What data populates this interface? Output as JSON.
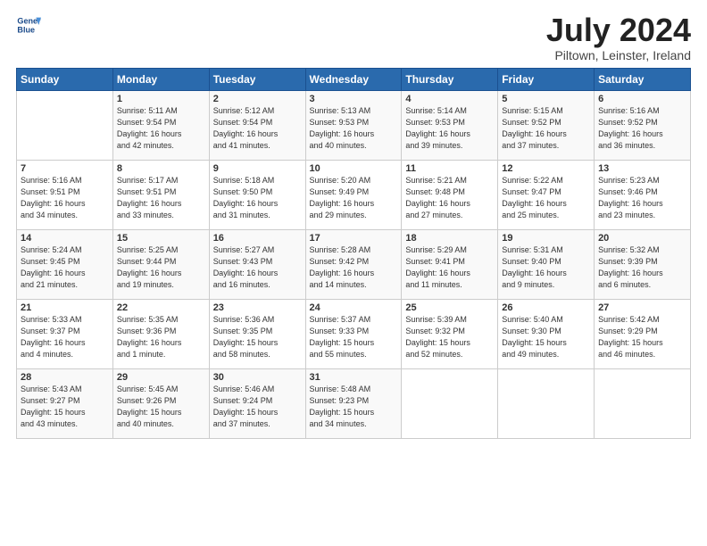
{
  "header": {
    "logo_line1": "General",
    "logo_line2": "Blue",
    "title": "July 2024",
    "subtitle": "Piltown, Leinster, Ireland"
  },
  "calendar": {
    "headers": [
      "Sunday",
      "Monday",
      "Tuesday",
      "Wednesday",
      "Thursday",
      "Friday",
      "Saturday"
    ],
    "weeks": [
      [
        {
          "day": "",
          "info": ""
        },
        {
          "day": "1",
          "info": "Sunrise: 5:11 AM\nSunset: 9:54 PM\nDaylight: 16 hours\nand 42 minutes."
        },
        {
          "day": "2",
          "info": "Sunrise: 5:12 AM\nSunset: 9:54 PM\nDaylight: 16 hours\nand 41 minutes."
        },
        {
          "day": "3",
          "info": "Sunrise: 5:13 AM\nSunset: 9:53 PM\nDaylight: 16 hours\nand 40 minutes."
        },
        {
          "day": "4",
          "info": "Sunrise: 5:14 AM\nSunset: 9:53 PM\nDaylight: 16 hours\nand 39 minutes."
        },
        {
          "day": "5",
          "info": "Sunrise: 5:15 AM\nSunset: 9:52 PM\nDaylight: 16 hours\nand 37 minutes."
        },
        {
          "day": "6",
          "info": "Sunrise: 5:16 AM\nSunset: 9:52 PM\nDaylight: 16 hours\nand 36 minutes."
        }
      ],
      [
        {
          "day": "7",
          "info": "Sunrise: 5:16 AM\nSunset: 9:51 PM\nDaylight: 16 hours\nand 34 minutes."
        },
        {
          "day": "8",
          "info": "Sunrise: 5:17 AM\nSunset: 9:51 PM\nDaylight: 16 hours\nand 33 minutes."
        },
        {
          "day": "9",
          "info": "Sunrise: 5:18 AM\nSunset: 9:50 PM\nDaylight: 16 hours\nand 31 minutes."
        },
        {
          "day": "10",
          "info": "Sunrise: 5:20 AM\nSunset: 9:49 PM\nDaylight: 16 hours\nand 29 minutes."
        },
        {
          "day": "11",
          "info": "Sunrise: 5:21 AM\nSunset: 9:48 PM\nDaylight: 16 hours\nand 27 minutes."
        },
        {
          "day": "12",
          "info": "Sunrise: 5:22 AM\nSunset: 9:47 PM\nDaylight: 16 hours\nand 25 minutes."
        },
        {
          "day": "13",
          "info": "Sunrise: 5:23 AM\nSunset: 9:46 PM\nDaylight: 16 hours\nand 23 minutes."
        }
      ],
      [
        {
          "day": "14",
          "info": "Sunrise: 5:24 AM\nSunset: 9:45 PM\nDaylight: 16 hours\nand 21 minutes."
        },
        {
          "day": "15",
          "info": "Sunrise: 5:25 AM\nSunset: 9:44 PM\nDaylight: 16 hours\nand 19 minutes."
        },
        {
          "day": "16",
          "info": "Sunrise: 5:27 AM\nSunset: 9:43 PM\nDaylight: 16 hours\nand 16 minutes."
        },
        {
          "day": "17",
          "info": "Sunrise: 5:28 AM\nSunset: 9:42 PM\nDaylight: 16 hours\nand 14 minutes."
        },
        {
          "day": "18",
          "info": "Sunrise: 5:29 AM\nSunset: 9:41 PM\nDaylight: 16 hours\nand 11 minutes."
        },
        {
          "day": "19",
          "info": "Sunrise: 5:31 AM\nSunset: 9:40 PM\nDaylight: 16 hours\nand 9 minutes."
        },
        {
          "day": "20",
          "info": "Sunrise: 5:32 AM\nSunset: 9:39 PM\nDaylight: 16 hours\nand 6 minutes."
        }
      ],
      [
        {
          "day": "21",
          "info": "Sunrise: 5:33 AM\nSunset: 9:37 PM\nDaylight: 16 hours\nand 4 minutes."
        },
        {
          "day": "22",
          "info": "Sunrise: 5:35 AM\nSunset: 9:36 PM\nDaylight: 16 hours\nand 1 minute."
        },
        {
          "day": "23",
          "info": "Sunrise: 5:36 AM\nSunset: 9:35 PM\nDaylight: 15 hours\nand 58 minutes."
        },
        {
          "day": "24",
          "info": "Sunrise: 5:37 AM\nSunset: 9:33 PM\nDaylight: 15 hours\nand 55 minutes."
        },
        {
          "day": "25",
          "info": "Sunrise: 5:39 AM\nSunset: 9:32 PM\nDaylight: 15 hours\nand 52 minutes."
        },
        {
          "day": "26",
          "info": "Sunrise: 5:40 AM\nSunset: 9:30 PM\nDaylight: 15 hours\nand 49 minutes."
        },
        {
          "day": "27",
          "info": "Sunrise: 5:42 AM\nSunset: 9:29 PM\nDaylight: 15 hours\nand 46 minutes."
        }
      ],
      [
        {
          "day": "28",
          "info": "Sunrise: 5:43 AM\nSunset: 9:27 PM\nDaylight: 15 hours\nand 43 minutes."
        },
        {
          "day": "29",
          "info": "Sunrise: 5:45 AM\nSunset: 9:26 PM\nDaylight: 15 hours\nand 40 minutes."
        },
        {
          "day": "30",
          "info": "Sunrise: 5:46 AM\nSunset: 9:24 PM\nDaylight: 15 hours\nand 37 minutes."
        },
        {
          "day": "31",
          "info": "Sunrise: 5:48 AM\nSunset: 9:23 PM\nDaylight: 15 hours\nand 34 minutes."
        },
        {
          "day": "",
          "info": ""
        },
        {
          "day": "",
          "info": ""
        },
        {
          "day": "",
          "info": ""
        }
      ]
    ]
  }
}
